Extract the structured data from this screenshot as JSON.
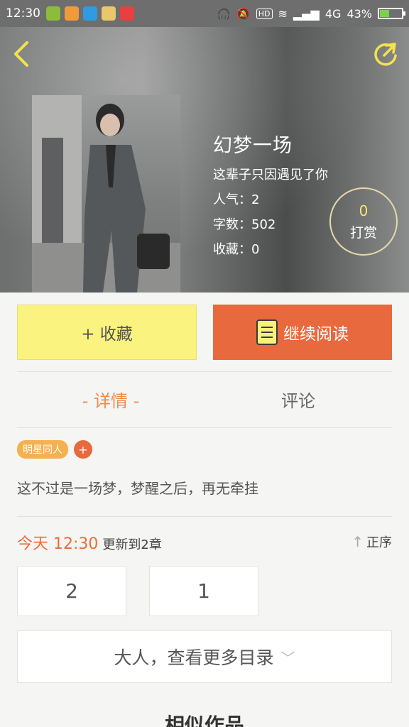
{
  "status_bar": {
    "time": "12:30",
    "network": "4G",
    "battery": "43%",
    "battery_level": 0.43,
    "hd_label": "HD"
  },
  "header": {
    "title": "幻梦一场",
    "subtitle": "这辈子只因遇见了你",
    "popularity": "人气：2",
    "word_count": "字数：502",
    "favorites": "收藏：0",
    "tip_count": "0",
    "tip_label": "打赏"
  },
  "actions": {
    "collect_label": "+ 收藏",
    "read_label": "继续阅读"
  },
  "tabs": {
    "detail": "- 详情 -",
    "comment": "评论"
  },
  "tag": {
    "name": "明星同人",
    "add": "+"
  },
  "description": "这不过是一场梦，梦醒之后，再无牵挂",
  "update": {
    "date": "今天 12:30",
    "chapters": "更新到2章",
    "sort_label": "正序"
  },
  "chapters": [
    "2",
    "1"
  ],
  "more_catalog": "大人，查看更多目录",
  "similar_title": "相似作品",
  "colors": {
    "accent": "#e8693d",
    "collect_yellow": "#fbf37f",
    "tab_active": "#ef8a4f"
  }
}
